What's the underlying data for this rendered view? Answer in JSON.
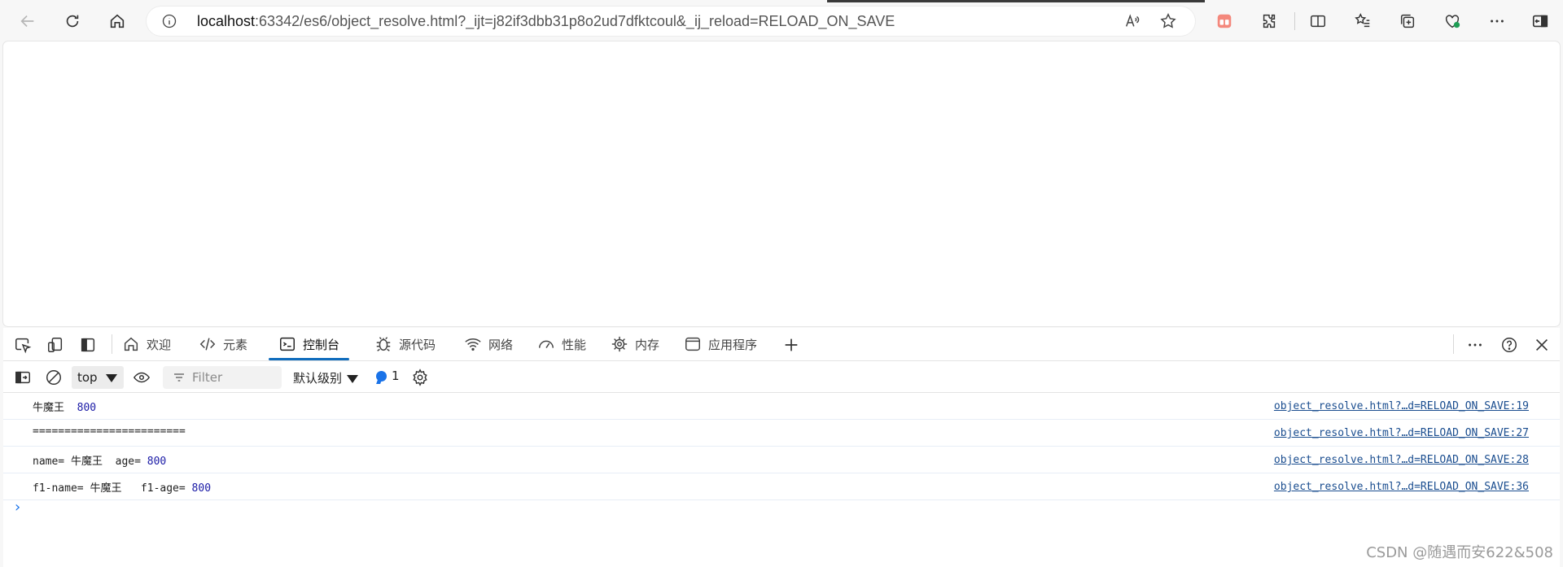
{
  "browser": {
    "url_host": "localhost",
    "url_rest": ":63342/es6/object_resolve.html?_ijt=j82if3dbb31p8o2ud7dfktcoul&_ij_reload=RELOAD_ON_SAVE"
  },
  "devtools": {
    "tabs": [
      {
        "label": "欢迎",
        "icon": "home-icon"
      },
      {
        "label": "元素",
        "icon": "code-icon"
      },
      {
        "label": "控制台",
        "icon": "console-icon",
        "active": true
      },
      {
        "label": "源代码",
        "icon": "bug-icon"
      },
      {
        "label": "网络",
        "icon": "wifi-icon"
      },
      {
        "label": "性能",
        "icon": "gauge-icon"
      },
      {
        "label": "内存",
        "icon": "chip-icon"
      },
      {
        "label": "应用程序",
        "icon": "window-icon"
      }
    ],
    "console": {
      "context": "top",
      "filter_placeholder": "Filter",
      "levels": "默认级别",
      "issues_count": "1",
      "logs": [
        {
          "parts": [
            {
              "t": "牛魔王  "
            },
            {
              "t": "800",
              "num": true
            }
          ],
          "source": "object_resolve.html?…d=RELOAD_ON_SAVE:19"
        },
        {
          "parts": [
            {
              "t": "========================"
            }
          ],
          "source": "object_resolve.html?…d=RELOAD_ON_SAVE:27"
        },
        {
          "parts": [
            {
              "t": "name= 牛魔王  age= "
            },
            {
              "t": "800",
              "num": true
            }
          ],
          "source": "object_resolve.html?…d=RELOAD_ON_SAVE:28"
        },
        {
          "parts": [
            {
              "t": "f1-name= 牛魔王   f1-age= "
            },
            {
              "t": "800",
              "num": true
            }
          ],
          "source": "object_resolve.html?…d=RELOAD_ON_SAVE:36"
        }
      ]
    }
  },
  "watermark": "CSDN @随遇而安622&508",
  "colors": {
    "accent": "#0f6cbd",
    "number": "#1a1aa6",
    "link": "#1a4d8f"
  }
}
